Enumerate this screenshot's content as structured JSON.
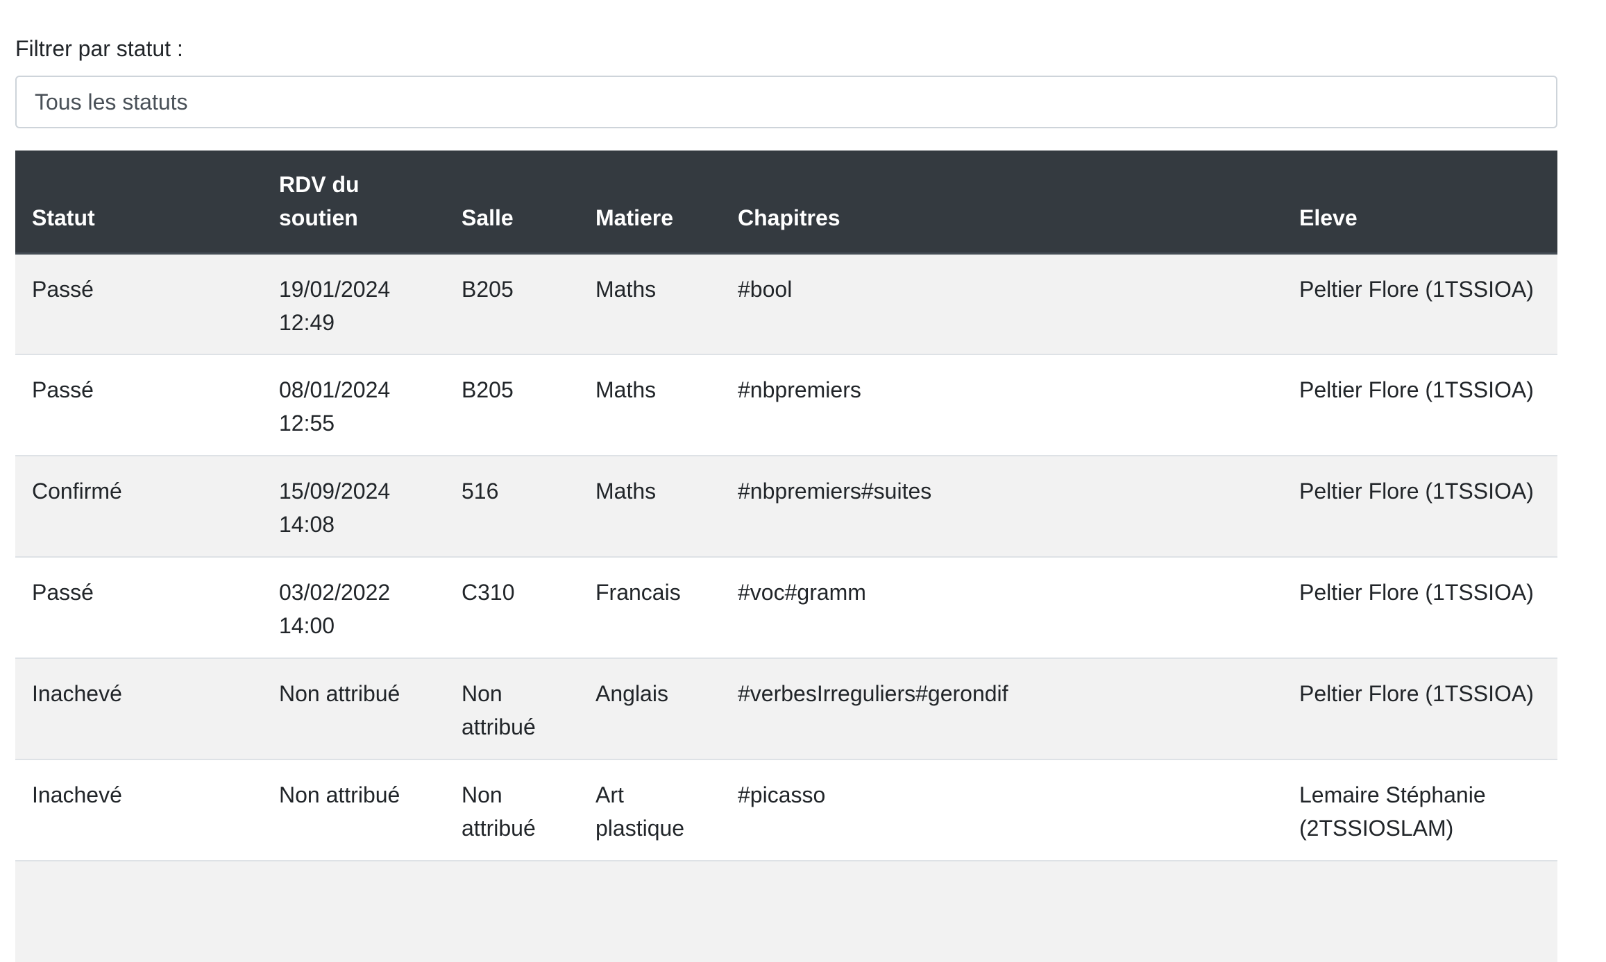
{
  "filter": {
    "label": "Filtrer par statut :",
    "selected": "Tous les statuts"
  },
  "table": {
    "headers": {
      "statut": "Statut",
      "rdv": "RDV du\nsoutien",
      "salle": "Salle",
      "matiere": "Matiere",
      "chapitres": "Chapitres",
      "eleve": "Eleve"
    },
    "rows": [
      {
        "statut": "Passé",
        "rdv": "19/01/2024\n12:49",
        "salle": "B205",
        "matiere": "Maths",
        "chapitres": "#bool",
        "eleve": "Peltier Flore (1TSSIOA)"
      },
      {
        "statut": "Passé",
        "rdv": "08/01/2024\n12:55",
        "salle": "B205",
        "matiere": "Maths",
        "chapitres": "#nbpremiers",
        "eleve": "Peltier Flore (1TSSIOA)"
      },
      {
        "statut": "Confirmé",
        "rdv": "15/09/2024\n14:08",
        "salle": "516",
        "matiere": "Maths",
        "chapitres": "#nbpremiers#suites",
        "eleve": "Peltier Flore (1TSSIOA)"
      },
      {
        "statut": "Passé",
        "rdv": "03/02/2022\n14:00",
        "salle": "C310",
        "matiere": "Francais",
        "chapitres": "#voc#gramm",
        "eleve": "Peltier Flore (1TSSIOA)"
      },
      {
        "statut": "Inachevé",
        "rdv": "Non attribué",
        "salle": "Non\nattribué",
        "matiere": "Anglais",
        "chapitres": "#verbesIrreguliers#gerondif",
        "eleve": "Peltier Flore (1TSSIOA)"
      },
      {
        "statut": "Inachevé",
        "rdv": "Non attribué",
        "salle": "Non\nattribué",
        "matiere": "Art\nplastique",
        "chapitres": "#picasso",
        "eleve": "Lemaire Stéphanie\n(2TSSIOSLAM)"
      },
      {
        "statut": "",
        "rdv": "",
        "salle": "",
        "matiere": "",
        "chapitres": "",
        "eleve": ""
      }
    ]
  }
}
